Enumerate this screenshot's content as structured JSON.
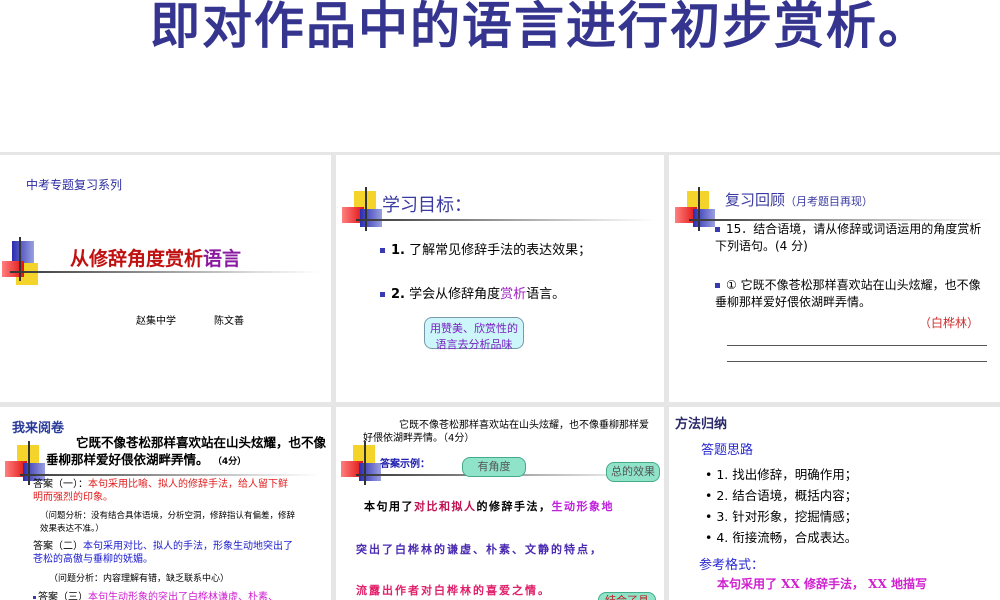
{
  "banner": {
    "title": "即对作品中的语言进行初步赏析。"
  },
  "slide1": {
    "series": "中考专题复习系列",
    "title_a": "从修辞角度赏析",
    "title_b": "语言",
    "school": "赵集中学",
    "author": "陈文善"
  },
  "slide2": {
    "heading": "学习目标：",
    "item1_num": "1.",
    "item1": "了解常见修辞手法的表达效果；",
    "item2_num": "2.",
    "item2_a": "学会从修辞角度",
    "item2_b": "赏析",
    "item2_c": "语言。",
    "bubble": "用赞美、欣赏性的语言去分析品味"
  },
  "slide3": {
    "heading": "复习回顾",
    "heading_sub": "（月考题目再现）",
    "q1": "15．结合语境，请从修辞或词语运用的角度赏析下列语句。(4 分)",
    "q2": "① 它既不像苍松那样喜欢站在山头炫耀，也不像垂柳那样爱好偎依湖畔弄情。",
    "source": "（白桦林）"
  },
  "slide4": {
    "heading": "我来阅卷",
    "sentence": "它既不像苍松那样喜欢站在山头炫耀，也不像垂柳那样爱好偎依湖畔弄情。",
    "score": "（4分）",
    "a1_label": "答案（一）：",
    "a1": "本句采用比喻、拟人的修辞手法，给人留下鲜明而强烈的印象。",
    "a1_note": "（问题分析：没有结合具体语境，分析空洞，修辞指认有偏差，修辞效果表达不准。）",
    "a2_label": "答案（二）",
    "a2": "本句采用对比、拟人的手法，形象生动地突出了苍松的高傲与垂柳的妩媚。",
    "a2_note": "（问题分析：内容理解有错，缺乏联系中心）",
    "a3_label": "答案（三）",
    "a3": "本句生动形象的突出了白桦林谦虚、朴素、"
  },
  "slide5": {
    "sentence": "它既不像苍松那样喜欢站在山头炫耀，也不像垂柳那样爱好偎依湖畔弄情。（4分）",
    "heading": "答案示例：",
    "bubble1": "有角度",
    "bubble2": "总的效果",
    "bubble3": "结合了具",
    "l1_a": "本句用了",
    "l1_b": "对比和拟人",
    "l1_c": "的修辞手法，",
    "l1_d": "生动形象地",
    "l2": "突出了白桦林的谦虚、朴素、文静的特点，",
    "l3": "流露出作者对白桦林的喜爱之情。"
  },
  "slide6": {
    "heading": "方法归纳",
    "sub1": "答题思路",
    "steps": [
      "1. 找出修辞，明确作用；",
      "2. 结合语境，概括内容；",
      "3. 针对形象，挖掘情感；",
      "4. 衔接流畅，合成表达。"
    ],
    "sub2": "参考格式：",
    "format": "本句采用了 XX 修辞手法， XX 地描写"
  }
}
